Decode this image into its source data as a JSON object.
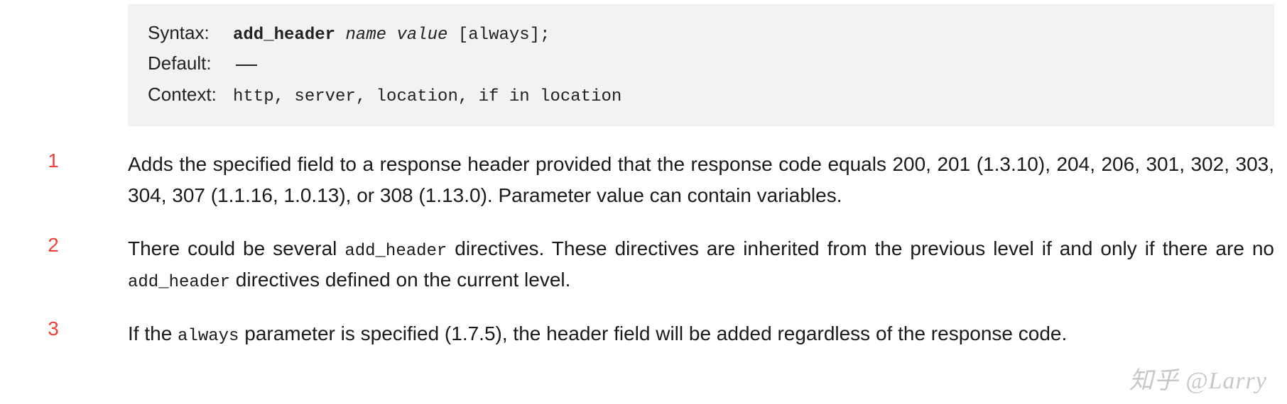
{
  "syntax": {
    "label_syntax": "Syntax:",
    "label_default": "Default:",
    "label_context": "Context:",
    "directive": "add_header",
    "args": "name value",
    "optional": "[always];",
    "default_value": "—",
    "context_value": "http, server, location, if in location"
  },
  "paragraphs": {
    "p1": {
      "num": "1",
      "text": "Adds the specified field to a response header provided that the response code equals 200, 201 (1.3.10), 204, 206, 301, 302, 303, 304, 307 (1.1.16, 1.0.13), or 308 (1.13.0). Parameter value can contain variables."
    },
    "p2": {
      "num": "2",
      "pre": "There could be several ",
      "code1": "add_header",
      "mid": " directives. These directives are inherited from the previous level if and only if there are no ",
      "code2": "add_header",
      "post": " directives defined on the current level."
    },
    "p3": {
      "num": "3",
      "pre": "If the ",
      "code1": "always",
      "post": " parameter is specified (1.7.5), the header field will be added regardless of the response code."
    }
  },
  "watermark": "知乎 @Larry"
}
